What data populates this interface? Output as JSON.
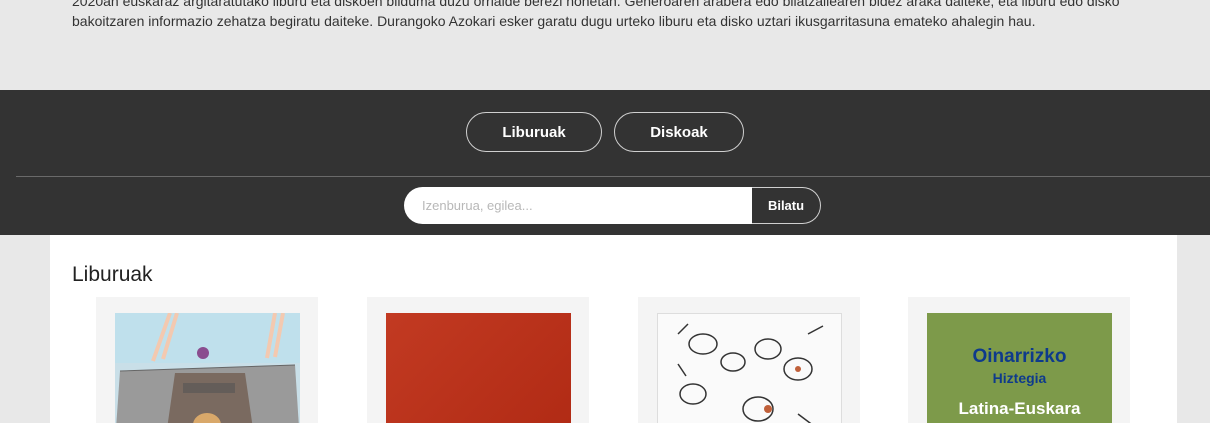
{
  "intro": {
    "text": "2020an euskaraz argitaratutako liburu eta diskoen bilduma duzu orrialde berezi honetan. Generoaren arabera edo bilatzailearen bidez araka daiteke, eta liburu edo disko bakoitzaren informazio zehatza begiratu daiteke. Durangoko Azokari esker garatu dugu urteko liburu eta disko uztari ikusgarritasuna emateko ahalegin hau."
  },
  "tabs": [
    {
      "label": "Liburuak"
    },
    {
      "label": "Diskoak"
    }
  ],
  "search": {
    "placeholder": "Izenburua, egilea...",
    "button": "Bilatu"
  },
  "section": {
    "title": "Liburuak"
  },
  "books": [
    {
      "cover": "book-cover-illustration"
    },
    {
      "cover": "book-cover-red"
    },
    {
      "cover": "book-cover-drawing"
    },
    {
      "cover": "book-cover-dictionary",
      "line1": "Oinarrizko",
      "line2": "Hiztegia",
      "line3": "Latina-Euskara"
    }
  ],
  "colors": {
    "dark_band": "#333333",
    "page_bg": "#e8e8e8",
    "cover_green": "#7d9a4a",
    "cover_blue_text": "#0e3a8c"
  }
}
